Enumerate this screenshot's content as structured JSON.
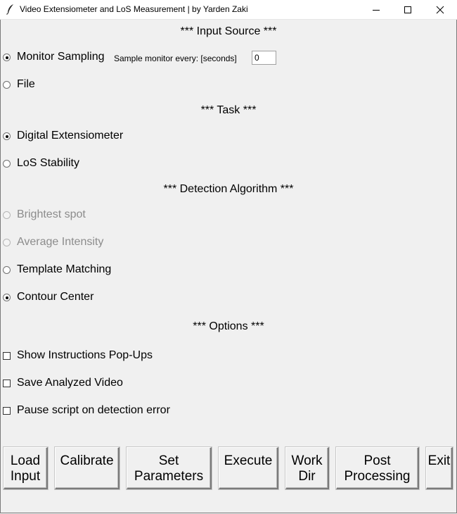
{
  "window": {
    "title": "Video Extensiometer and LoS Measurement | by Yarden Zaki",
    "controls": {
      "minimize": "minimize-icon",
      "maximize": "maximize-icon",
      "close": "close-icon"
    }
  },
  "input_source": {
    "header": "*** Input Source ***",
    "options": [
      {
        "label": "Monitor Sampling",
        "selected": true
      },
      {
        "label": "File",
        "selected": false
      }
    ],
    "sample_label": "Sample monitor every: [seconds]",
    "sample_value": "0"
  },
  "task": {
    "header": "*** Task ***",
    "options": [
      {
        "label": "Digital Extensiometer",
        "selected": true
      },
      {
        "label": "LoS Stability",
        "selected": false
      }
    ]
  },
  "detection": {
    "header": "*** Detection Algorithm ***",
    "options": [
      {
        "label": "Brightest spot",
        "selected": false,
        "disabled": true
      },
      {
        "label": "Average Intensity",
        "selected": false,
        "disabled": true
      },
      {
        "label": "Template Matching",
        "selected": false,
        "disabled": false
      },
      {
        "label": "Contour Center",
        "selected": true,
        "disabled": false
      }
    ]
  },
  "options": {
    "header": "*** Options ***",
    "items": [
      {
        "label": "Show Instructions Pop-Ups",
        "checked": false
      },
      {
        "label": "Save Analyzed Video",
        "checked": false
      },
      {
        "label": "Pause script on detection error",
        "checked": false
      }
    ]
  },
  "buttons": [
    {
      "label": "Load\nInput"
    },
    {
      "label": "Calibrate"
    },
    {
      "label": "Set\nParameters"
    },
    {
      "label": "Execute"
    },
    {
      "label": "Work\nDir"
    },
    {
      "label": "Post\nProcessing"
    },
    {
      "label": "Exit"
    }
  ]
}
